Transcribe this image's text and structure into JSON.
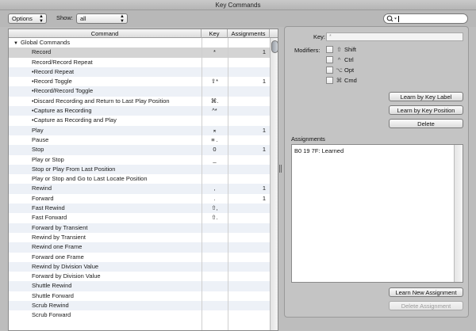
{
  "window": {
    "title": "Key Commands"
  },
  "toolbar": {
    "options_label": "Options",
    "show_label": "Show:",
    "show_value": "all",
    "search_value": ""
  },
  "table": {
    "columns": [
      "Command",
      "Key",
      "Assignments"
    ],
    "rows": [
      {
        "command": "Global Commands",
        "key": "",
        "assignments": "",
        "group": true
      },
      {
        "command": "Record",
        "key": "*",
        "assignments": "1",
        "selected": true
      },
      {
        "command": "Record/Record Repeat",
        "key": "",
        "assignments": ""
      },
      {
        "command": "•Record Repeat",
        "key": "",
        "assignments": ""
      },
      {
        "command": "•Record Toggle",
        "key": "⇧*",
        "assignments": "1"
      },
      {
        "command": "•Record/Record Toggle",
        "key": "",
        "assignments": ""
      },
      {
        "command": "•Discard Recording and Return to Last Play Position",
        "key": "⌘.",
        "assignments": ""
      },
      {
        "command": "•Capture as Recording",
        "key": "^*",
        "assignments": ""
      },
      {
        "command": "•Capture as Recording and Play",
        "key": "",
        "assignments": ""
      },
      {
        "command": "Play",
        "key": "⌅",
        "assignments": "1"
      },
      {
        "command": "Pause",
        "key": "≡ .",
        "assignments": ""
      },
      {
        "command": "Stop",
        "key": "0",
        "assignments": "1"
      },
      {
        "command": "Play or Stop",
        "key": "_",
        "assignments": ""
      },
      {
        "command": "Stop or Play From Last Position",
        "key": "",
        "assignments": ""
      },
      {
        "command": "Play or Stop and Go to Last Locate Position",
        "key": "",
        "assignments": ""
      },
      {
        "command": "Rewind",
        "key": ",",
        "assignments": "1"
      },
      {
        "command": "Forward",
        "key": ".",
        "assignments": "1"
      },
      {
        "command": "Fast Rewind",
        "key": "⇧,",
        "assignments": ""
      },
      {
        "command": "Fast Forward",
        "key": "⇧.",
        "assignments": ""
      },
      {
        "command": "Forward by Transient",
        "key": "",
        "assignments": ""
      },
      {
        "command": "Rewind by Transient",
        "key": "",
        "assignments": ""
      },
      {
        "command": "Rewind one Frame",
        "key": "",
        "assignments": ""
      },
      {
        "command": "Forward one Frame",
        "key": "",
        "assignments": ""
      },
      {
        "command": "Rewind by Division Value",
        "key": "",
        "assignments": ""
      },
      {
        "command": "Forward by Division Value",
        "key": "",
        "assignments": ""
      },
      {
        "command": "Shuttle Rewind",
        "key": "",
        "assignments": ""
      },
      {
        "command": "Shuttle Forward",
        "key": "",
        "assignments": ""
      },
      {
        "command": "Scrub Rewind",
        "key": "",
        "assignments": ""
      },
      {
        "command": "Scrub Forward",
        "key": "",
        "assignments": ""
      }
    ]
  },
  "panel": {
    "key_label": "Key:",
    "key_placeholder": "*",
    "modifiers_label": "Modifiers:",
    "modifiers": [
      {
        "symbol": "⇧",
        "name": "Shift",
        "icon": "shift-icon"
      },
      {
        "symbol": "^",
        "name": "Ctrl",
        "icon": "control-icon"
      },
      {
        "symbol": "⌥",
        "name": "Opt",
        "icon": "option-icon"
      },
      {
        "symbol": "⌘",
        "name": "Cmd",
        "icon": "command-icon"
      }
    ],
    "learn_by_label": "Learn by Key Label",
    "learn_by_position": "Learn by Key Position",
    "delete": "Delete",
    "assignments_heading": "Assignments",
    "assignments": [
      "B0 19 7F: Learned"
    ],
    "learn_new_assignment": "Learn New Assignment",
    "delete_assignment": "Delete Assignment"
  }
}
